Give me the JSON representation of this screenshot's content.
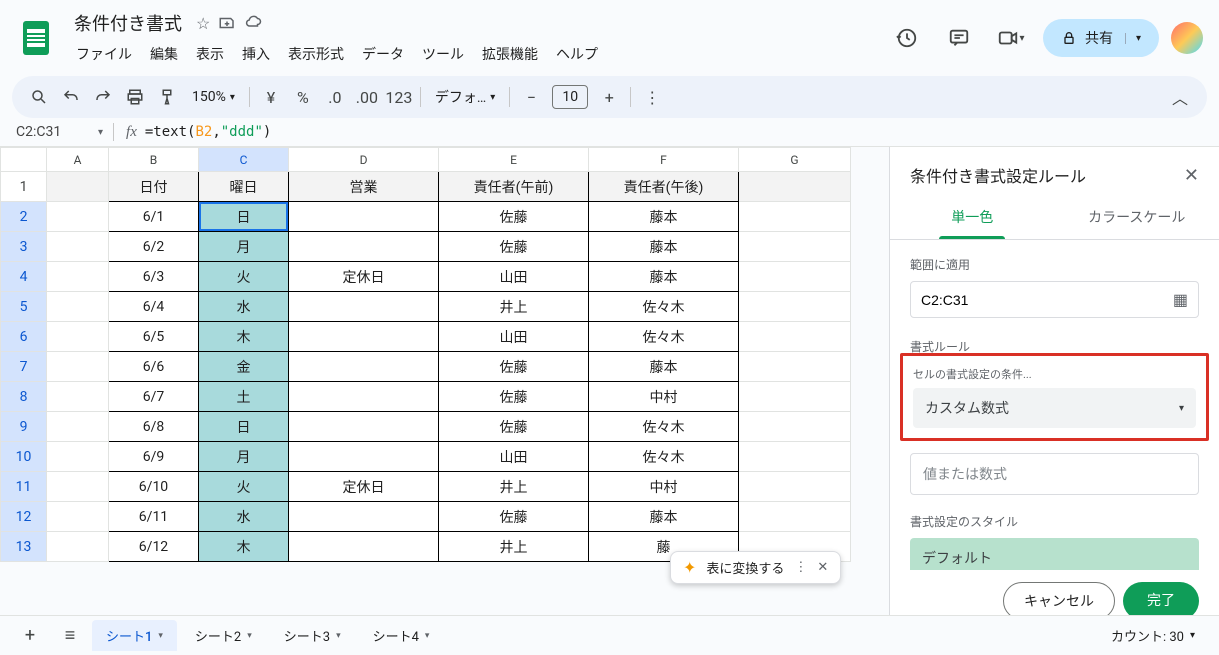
{
  "doc_title": "条件付き書式",
  "menus": [
    "ファイル",
    "編集",
    "表示",
    "挿入",
    "表示形式",
    "データ",
    "ツール",
    "拡張機能",
    "ヘルプ"
  ],
  "share_label": "共有",
  "toolbar": {
    "zoom": "150%",
    "currency": "¥",
    "percent": "%",
    "font": "デフォ…",
    "font_size": "10"
  },
  "name_box": "C2:C31",
  "formula": {
    "eq": "=",
    "fn": "text",
    "open": "(",
    "ref": "B2",
    "comma": ",",
    "str": "\"ddd\"",
    "close": ")"
  },
  "columns": [
    "A",
    "B",
    "C",
    "D",
    "E",
    "F",
    "G"
  ],
  "header_row": [
    "",
    "日付",
    "曜日",
    "営業",
    "責任者(午前)",
    "責任者(午後)",
    ""
  ],
  "rows": [
    {
      "n": 2,
      "b": "6/1",
      "c": "日",
      "d": "",
      "e": "佐藤",
      "f": "藤本"
    },
    {
      "n": 3,
      "b": "6/2",
      "c": "月",
      "d": "",
      "e": "佐藤",
      "f": "藤本"
    },
    {
      "n": 4,
      "b": "6/3",
      "c": "火",
      "d": "定休日",
      "e": "山田",
      "f": "藤本"
    },
    {
      "n": 5,
      "b": "6/4",
      "c": "水",
      "d": "",
      "e": "井上",
      "f": "佐々木"
    },
    {
      "n": 6,
      "b": "6/5",
      "c": "木",
      "d": "",
      "e": "山田",
      "f": "佐々木"
    },
    {
      "n": 7,
      "b": "6/6",
      "c": "金",
      "d": "",
      "e": "佐藤",
      "f": "藤本"
    },
    {
      "n": 8,
      "b": "6/7",
      "c": "土",
      "d": "",
      "e": "佐藤",
      "f": "中村"
    },
    {
      "n": 9,
      "b": "6/8",
      "c": "日",
      "d": "",
      "e": "佐藤",
      "f": "佐々木"
    },
    {
      "n": 10,
      "b": "6/9",
      "c": "月",
      "d": "",
      "e": "山田",
      "f": "佐々木"
    },
    {
      "n": 11,
      "b": "6/10",
      "c": "火",
      "d": "定休日",
      "e": "井上",
      "f": "中村"
    },
    {
      "n": 12,
      "b": "6/11",
      "c": "水",
      "d": "",
      "e": "佐藤",
      "f": "藤本"
    },
    {
      "n": 13,
      "b": "6/12",
      "c": "木",
      "d": "",
      "e": "井上",
      "f": "藤"
    }
  ],
  "side_panel": {
    "title": "条件付き書式設定ルール",
    "tab_single": "単一色",
    "tab_scale": "カラースケール",
    "apply_range_label": "範囲に適用",
    "range_value": "C2:C31",
    "rules_label": "書式ルール",
    "condition_sub": "セルの書式設定の条件...",
    "condition_value": "カスタム数式",
    "value_placeholder": "値または数式",
    "style_label": "書式設定のスタイル",
    "style_preview": "デフォルト",
    "cancel": "キャンセル",
    "done": "完了"
  },
  "convert_popup": "表に変換する",
  "sheet_tabs": [
    "シート1",
    "シート2",
    "シート3",
    "シート4"
  ],
  "count_label": "カウント: 30"
}
